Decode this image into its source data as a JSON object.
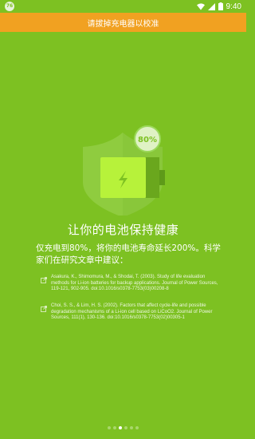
{
  "status": {
    "badge": "76",
    "time": "9:40"
  },
  "banner": {
    "text": "请拔掉充电器以校准"
  },
  "hero": {
    "percent": "80%"
  },
  "headline": "让你的电池保持健康",
  "description": "仅充电到80%，将你的电池寿命延长200%。科学家们在研究文章中建议：",
  "references": [
    {
      "text": "Asakura, K., Shimomura, M., & Shodai, T. (2003). Study of life evaluation methods for Li-ion batteries for backup applications. Journal of Power Sources, 119-121, 902-905. doi:10.1016/s0378-7753(03)00208-8"
    },
    {
      "text": "Choi, S. S., & Lim, H. S. (2002). Factors that affect cycle-life and possible degradation mechanisms of a Li-ion cell based on LiCoO2. Journal of Power Sources, 111(1), 130-136. doi:10.1016/s0378-7753(02)00305-1"
    }
  ],
  "pager": {
    "count": 6,
    "active_index": 2
  },
  "colors": {
    "background": "#7dc122",
    "banner": "#f1a121",
    "shield": "#8fcc3f",
    "battery": "#b7f23a"
  }
}
